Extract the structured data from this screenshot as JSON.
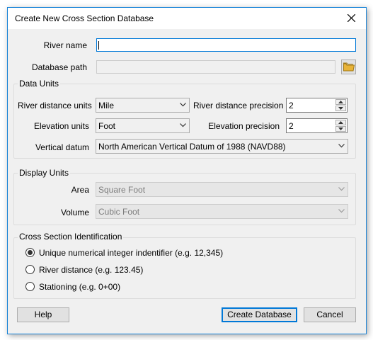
{
  "window": {
    "title": "Create New Cross Section Database"
  },
  "fields": {
    "river_name": {
      "label": "River name",
      "value": ""
    },
    "database_path": {
      "label": "Database path",
      "value": ""
    }
  },
  "data_units": {
    "title": "Data Units",
    "river_distance_units": {
      "label": "River distance units",
      "value": "Mile"
    },
    "river_distance_precision": {
      "label": "River distance precision",
      "value": "2"
    },
    "elevation_units": {
      "label": "Elevation units",
      "value": "Foot"
    },
    "elevation_precision": {
      "label": "Elevation precision",
      "value": "2"
    },
    "vertical_datum": {
      "label": "Vertical datum",
      "value": "North American Vertical Datum of 1988 (NAVD88)"
    }
  },
  "display_units": {
    "title": "Display Units",
    "area": {
      "label": "Area",
      "value": "Square Foot"
    },
    "volume": {
      "label": "Volume",
      "value": "Cubic Foot"
    }
  },
  "cross_section_id": {
    "title": "Cross Section Identification",
    "options": [
      {
        "label": "Unique numerical integer indentifier (e.g. 12,345)",
        "checked": true
      },
      {
        "label": "River distance (e.g. 123.45)",
        "checked": false
      },
      {
        "label": "Stationing (e.g. 0+00)",
        "checked": false
      }
    ]
  },
  "buttons": {
    "help": "Help",
    "create": "Create Database",
    "cancel": "Cancel"
  },
  "icons": {
    "close": "close-icon",
    "folder": "folder-icon",
    "dropdown": "chevron-down-icon",
    "spin_up": "spin-up-icon",
    "spin_down": "spin-down-icon"
  },
  "colors": {
    "accent": "#0078d7",
    "window_border": "#1883d7",
    "dialog_bg": "#f0f0f0",
    "folder": "#e8b339"
  }
}
